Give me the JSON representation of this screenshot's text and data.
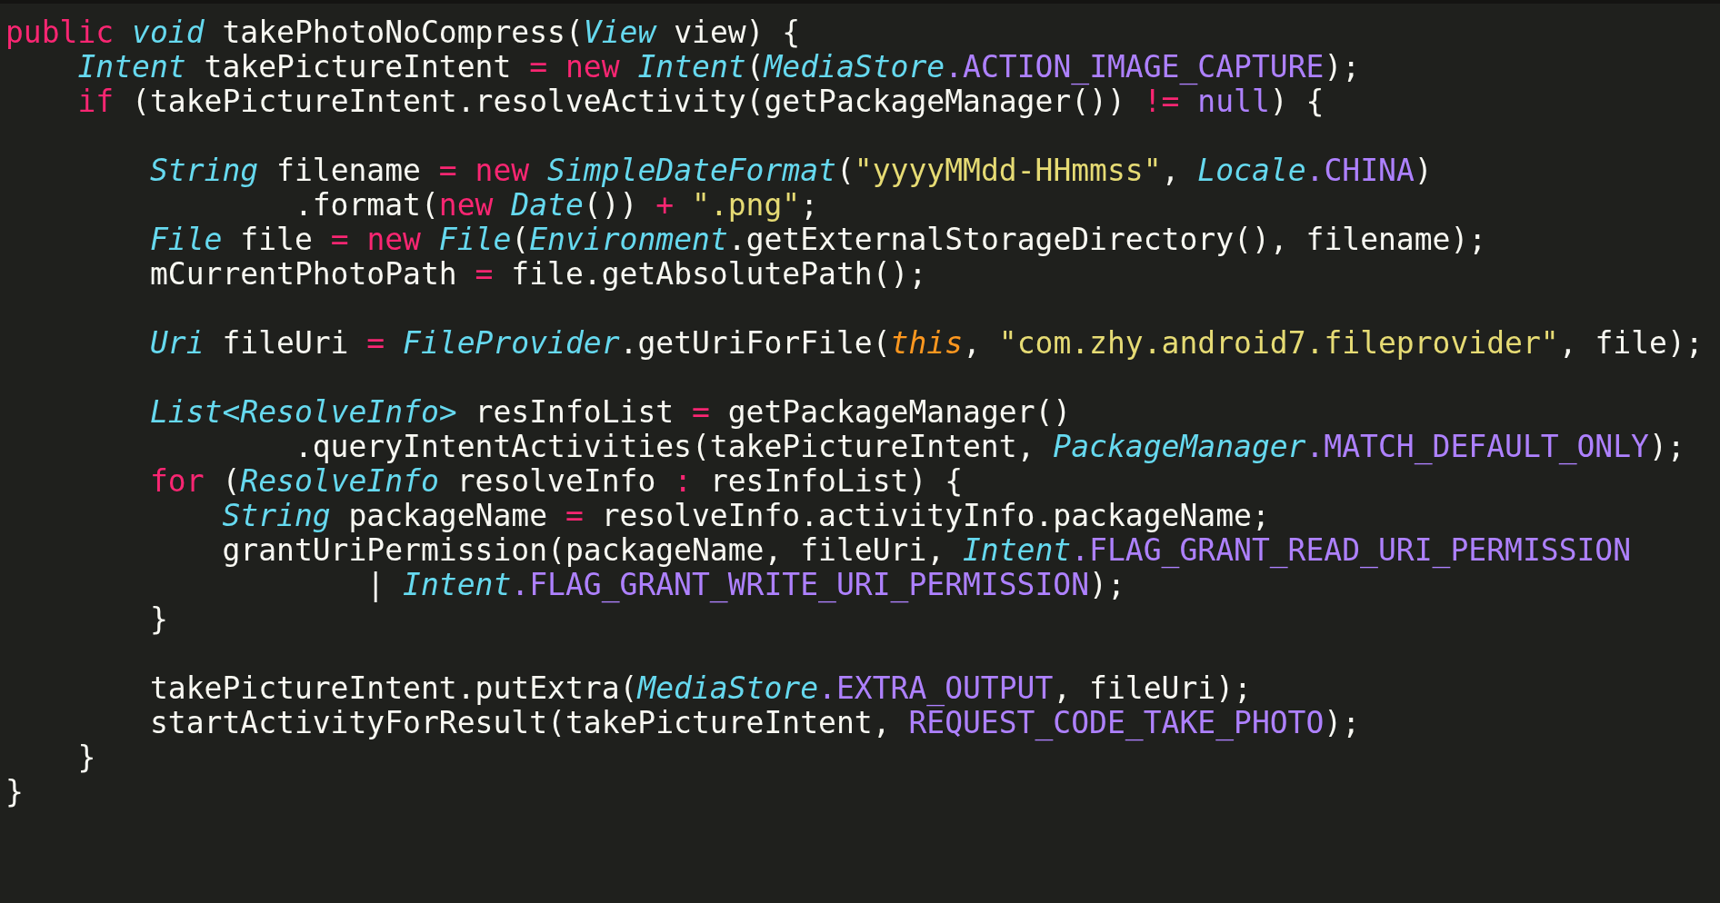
{
  "editor": {
    "lines": [
      {
        "kind": "code",
        "tokens": [
          {
            "kind": "keyword",
            "text": "public"
          },
          {
            "kind": "type",
            "text": " void"
          },
          {
            "kind": "plain",
            "text": " takePhotoNoCompress("
          },
          {
            "kind": "type",
            "text": "View"
          },
          {
            "kind": "plain",
            "text": " view) {"
          }
        ]
      },
      {
        "kind": "code",
        "tokens": [
          {
            "kind": "type",
            "text": "    Intent"
          },
          {
            "kind": "plain",
            "text": " takePictureIntent"
          },
          {
            "kind": "keyword",
            "text": " ="
          },
          {
            "kind": "keyword",
            "text": " new"
          },
          {
            "kind": "type",
            "text": " Intent"
          },
          {
            "kind": "plain",
            "text": "("
          },
          {
            "kind": "type",
            "text": "MediaStore"
          },
          {
            "kind": "constant",
            "text": ".ACTION_IMAGE_CAPTURE"
          },
          {
            "kind": "plain",
            "text": ");"
          }
        ]
      },
      {
        "kind": "code",
        "tokens": [
          {
            "kind": "keyword",
            "text": "    if"
          },
          {
            "kind": "plain",
            "text": " (takePictureIntent.resolveActivity(getPackageManager())"
          },
          {
            "kind": "keyword",
            "text": " !="
          },
          {
            "kind": "constant",
            "text": " null"
          },
          {
            "kind": "plain",
            "text": ") {"
          }
        ]
      },
      {
        "kind": "blank"
      },
      {
        "kind": "code",
        "tokens": [
          {
            "kind": "type",
            "text": "        String"
          },
          {
            "kind": "plain",
            "text": " filename"
          },
          {
            "kind": "keyword",
            "text": " ="
          },
          {
            "kind": "keyword",
            "text": " new"
          },
          {
            "kind": "type",
            "text": " SimpleDateFormat"
          },
          {
            "kind": "plain",
            "text": "("
          },
          {
            "kind": "string",
            "text": "\"yyyyMMdd-HHmmss\""
          },
          {
            "kind": "plain",
            "text": ","
          },
          {
            "kind": "type",
            "text": " Locale"
          },
          {
            "kind": "constant",
            "text": ".CHINA"
          },
          {
            "kind": "plain",
            "text": ")"
          }
        ]
      },
      {
        "kind": "code",
        "tokens": [
          {
            "kind": "plain",
            "text": "                .format("
          },
          {
            "kind": "keyword",
            "text": "new"
          },
          {
            "kind": "type",
            "text": " Date"
          },
          {
            "kind": "plain",
            "text": "())"
          },
          {
            "kind": "keyword",
            "text": " +"
          },
          {
            "kind": "string",
            "text": " \".png\""
          },
          {
            "kind": "plain",
            "text": ";"
          }
        ]
      },
      {
        "kind": "code",
        "tokens": [
          {
            "kind": "type",
            "text": "        File"
          },
          {
            "kind": "plain",
            "text": " file"
          },
          {
            "kind": "keyword",
            "text": " ="
          },
          {
            "kind": "keyword",
            "text": " new"
          },
          {
            "kind": "type",
            "text": " File"
          },
          {
            "kind": "plain",
            "text": "("
          },
          {
            "kind": "type",
            "text": "Environment"
          },
          {
            "kind": "plain",
            "text": ".getExternalStorageDirectory(), filename);"
          }
        ]
      },
      {
        "kind": "code",
        "tokens": [
          {
            "kind": "plain",
            "text": "        mCurrentPhotoPath"
          },
          {
            "kind": "keyword",
            "text": " ="
          },
          {
            "kind": "plain",
            "text": " file.getAbsolutePath();"
          }
        ]
      },
      {
        "kind": "blank"
      },
      {
        "kind": "code",
        "tokens": [
          {
            "kind": "type",
            "text": "        Uri"
          },
          {
            "kind": "plain",
            "text": " fileUri"
          },
          {
            "kind": "keyword",
            "text": " ="
          },
          {
            "kind": "type",
            "text": " FileProvider"
          },
          {
            "kind": "plain",
            "text": ".getUriForFile("
          },
          {
            "kind": "variable",
            "text": "this"
          },
          {
            "kind": "plain",
            "text": ","
          },
          {
            "kind": "string",
            "text": " \"com.zhy.android7.fileprovider\""
          },
          {
            "kind": "plain",
            "text": ", file);"
          }
        ]
      },
      {
        "kind": "blank"
      },
      {
        "kind": "code",
        "tokens": [
          {
            "kind": "type",
            "text": "        List<ResolveInfo>"
          },
          {
            "kind": "plain",
            "text": " resInfoList"
          },
          {
            "kind": "keyword",
            "text": " ="
          },
          {
            "kind": "plain",
            "text": " getPackageManager()"
          }
        ]
      },
      {
        "kind": "code",
        "tokens": [
          {
            "kind": "plain",
            "text": "                .queryIntentActivities(takePictureIntent,"
          },
          {
            "kind": "type",
            "text": " PackageManager"
          },
          {
            "kind": "constant",
            "text": ".MATCH_DEFAULT_ONLY"
          },
          {
            "kind": "plain",
            "text": ");"
          }
        ]
      },
      {
        "kind": "code",
        "tokens": [
          {
            "kind": "keyword",
            "text": "        for"
          },
          {
            "kind": "plain",
            "text": " ("
          },
          {
            "kind": "type",
            "text": "ResolveInfo"
          },
          {
            "kind": "plain",
            "text": " resolveInfo"
          },
          {
            "kind": "keyword",
            "text": " :"
          },
          {
            "kind": "plain",
            "text": " resInfoList) {"
          }
        ]
      },
      {
        "kind": "code",
        "tokens": [
          {
            "kind": "type",
            "text": "            String"
          },
          {
            "kind": "plain",
            "text": " packageName"
          },
          {
            "kind": "keyword",
            "text": " ="
          },
          {
            "kind": "plain",
            "text": " resolveInfo.activityInfo.packageName;"
          }
        ]
      },
      {
        "kind": "code",
        "tokens": [
          {
            "kind": "plain",
            "text": "            grantUriPermission(packageName, fileUri,"
          },
          {
            "kind": "type",
            "text": " Intent"
          },
          {
            "kind": "constant",
            "text": ".FLAG_GRANT_READ_URI_PERMISSION"
          }
        ]
      },
      {
        "kind": "code",
        "tokens": [
          {
            "kind": "plain",
            "text": "                    |"
          },
          {
            "kind": "type",
            "text": " Intent"
          },
          {
            "kind": "constant",
            "text": ".FLAG_GRANT_WRITE_URI_PERMISSION"
          },
          {
            "kind": "plain",
            "text": ");"
          }
        ]
      },
      {
        "kind": "code",
        "tokens": [
          {
            "kind": "plain",
            "text": "        }"
          }
        ]
      },
      {
        "kind": "blank"
      },
      {
        "kind": "code",
        "tokens": [
          {
            "kind": "plain",
            "text": "        takePictureIntent.putExtra("
          },
          {
            "kind": "type",
            "text": "MediaStore"
          },
          {
            "kind": "constant",
            "text": ".EXTRA_OUTPUT"
          },
          {
            "kind": "plain",
            "text": ", fileUri);"
          }
        ]
      },
      {
        "kind": "code",
        "tokens": [
          {
            "kind": "plain",
            "text": "        startActivityForResult(takePictureIntent,"
          },
          {
            "kind": "constant",
            "text": " REQUEST_CODE_TAKE_PHOTO"
          },
          {
            "kind": "plain",
            "text": ");"
          }
        ]
      },
      {
        "kind": "code",
        "tokens": [
          {
            "kind": "plain",
            "text": "    }"
          }
        ]
      },
      {
        "kind": "code",
        "tokens": [
          {
            "kind": "plain",
            "text": "}"
          }
        ]
      }
    ]
  }
}
